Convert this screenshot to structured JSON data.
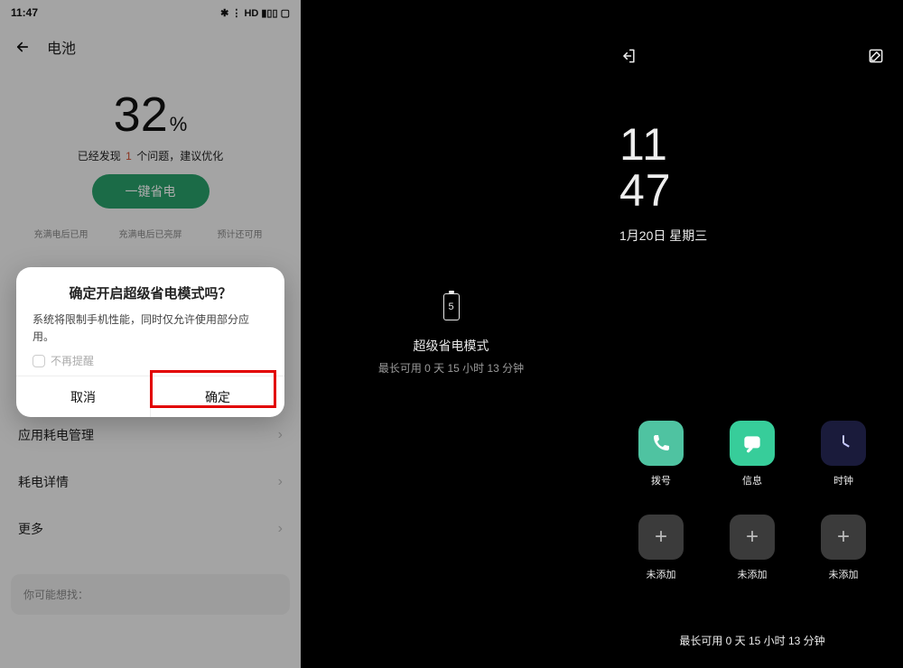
{
  "panel1": {
    "statusbar": {
      "time": "11:47",
      "icons": "✱ ⋮ HD ▮▯▯ ▢"
    },
    "header_title": "电池",
    "battery_value": "32",
    "battery_pct_sign": "%",
    "found_prefix": "已经发现",
    "found_count": "1",
    "found_suffix": "个问题，建议优化",
    "optimize_btn": "一键省电",
    "charge_cols": {
      "col1": "充满电后已用",
      "col2": "充满电后已亮屏",
      "col3": "预计还可用"
    },
    "menu": {
      "item1": "应用耗电管理",
      "item2": "耗电详情",
      "item3": "更多"
    },
    "want_find": "你可能想找：",
    "modal": {
      "title": "确定开启超级省电模式吗？",
      "body": "系统将限制手机性能，同时仅允许使用部分应用。",
      "check": "不再提醒",
      "cancel": "取消",
      "confirm": "确定"
    }
  },
  "panel2": {
    "bat_num": "5",
    "title": "超级省电模式",
    "subtitle": "最长可用 0 天 15 小时 13 分钟"
  },
  "panel3": {
    "clock_h": "11",
    "clock_m": "47",
    "date": "1月20日 星期三",
    "apps": {
      "dial": "拨号",
      "msg": "信息",
      "clk": "时钟",
      "add": "未添加"
    },
    "bottom": "最长可用 0 天 15 小时 13 分钟"
  }
}
